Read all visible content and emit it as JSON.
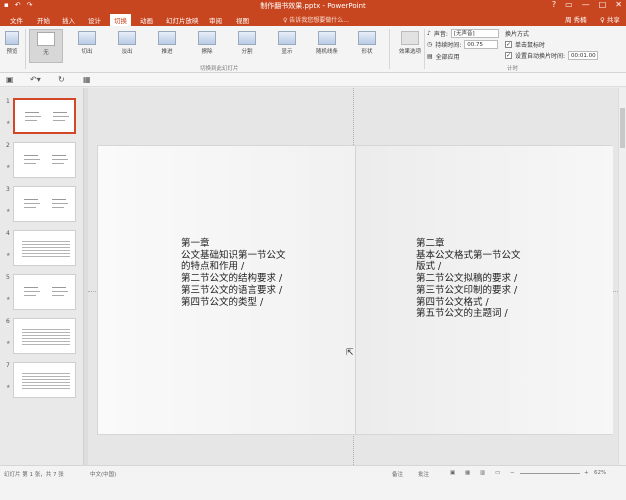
{
  "window": {
    "title": "制作翻书效果.pptx - PowerPoint",
    "controls": [
      "?",
      "▭",
      "—",
      "□",
      "✕"
    ]
  },
  "tabs": [
    "文件",
    "开始",
    "插入",
    "设计",
    "切换",
    "动画",
    "幻灯片放映",
    "审阅",
    "视图"
  ],
  "tellme": "♀ 告诉我您想要做什么...",
  "user": "周 秀楠",
  "share": "♀ 共享",
  "ribbon": {
    "preview": "预览",
    "transitions": [
      "无",
      "切出",
      "淡出",
      "推进",
      "擦除",
      "分割",
      "显示",
      "随机线条",
      "形状"
    ],
    "effect_options": "效果选项",
    "group_label": "切换到此幻灯片",
    "sound_label": "声音:",
    "sound_value": "[无声音]",
    "duration_label": "持续时间:",
    "duration_value": "00.75",
    "apply_all": "全部应用",
    "advance_label": "换片方式",
    "on_click": "单击鼠标时",
    "after_label": "设置自动换片时间:",
    "after_value": "00:01.00",
    "timing_group": "计时"
  },
  "thumbnails": [
    {
      "num": "1",
      "style": "lines"
    },
    {
      "num": "2",
      "style": "lines"
    },
    {
      "num": "3",
      "style": "lines"
    },
    {
      "num": "4",
      "style": "dense"
    },
    {
      "num": "5",
      "style": "lines"
    },
    {
      "num": "6",
      "style": "dense"
    },
    {
      "num": "7",
      "style": "dense"
    }
  ],
  "slide": {
    "left_lines": [
      "第一章",
      "公文基础知识第一节公文",
      "的特点和作用 /",
      "第二节公文的结构要求 /",
      "第三节公文的语言要求 /",
      "第四节公文的类型 /"
    ],
    "right_lines": [
      "第二章",
      "基本公文格式第一节公文",
      "版式 /",
      "第二节公文拟稿的要求 /",
      "第三节公文印制的要求 /",
      "第四节公文格式 /",
      "第五节公文的主题词 /"
    ]
  },
  "status": {
    "slide_info": "幻灯片 第 1 张，共 7 张",
    "lang": "中文(中国)",
    "notes": "备注",
    "comments": "批注",
    "zoom": "62%"
  }
}
